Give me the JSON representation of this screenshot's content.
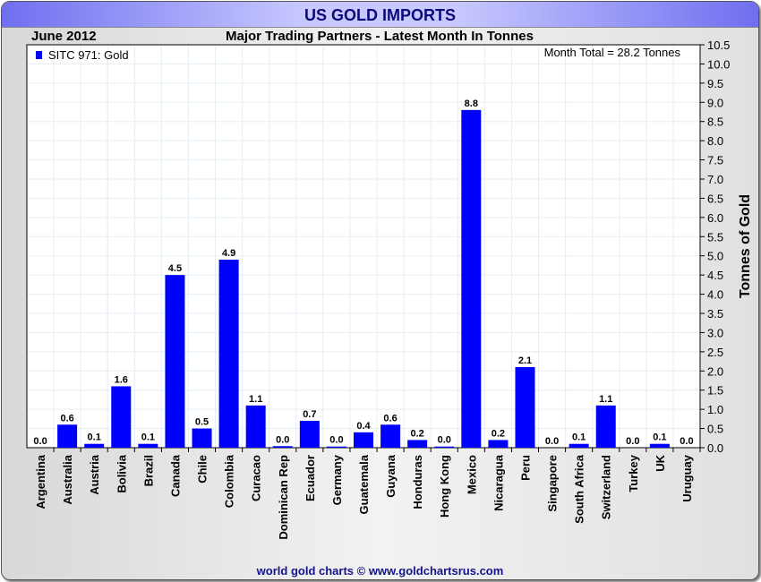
{
  "header": {
    "title": "US GOLD IMPORTS",
    "period": "June 2012",
    "subtitle": "Major Trading Partners - Latest Month In Tonnes"
  },
  "footer": "world gold charts © www.goldchartsrus.com",
  "chart_data": {
    "type": "bar",
    "title": "Major Trading Partners - Latest Month In Tonnes",
    "ylabel": "Tonnes of Gold",
    "ylim": [
      0,
      10.5
    ],
    "ytick_step": 0.5,
    "grid": true,
    "legend": {
      "label": "SITC 971: Gold",
      "placement": "top-left",
      "color": "#0000ff"
    },
    "annotation": "Month Total = 28.2 Tonnes",
    "categories": [
      "Argentina",
      "Australia",
      "Austria",
      "Bolivia",
      "Brazil",
      "Canada",
      "Chile",
      "Colombia",
      "Curacao",
      "Dominican Rep",
      "Ecuador",
      "Germany",
      "Guatemala",
      "Guyana",
      "Honduras",
      "Hong Kong",
      "Mexico",
      "Nicaragua",
      "Peru",
      "Singapore",
      "South Africa",
      "Switzerland",
      "Turkey",
      "UK",
      "Uruguay"
    ],
    "values": [
      0.0,
      0.6,
      0.1,
      1.6,
      0.1,
      4.5,
      0.5,
      4.9,
      1.1,
      0.04,
      0.7,
      0.03,
      0.4,
      0.6,
      0.2,
      0.03,
      8.8,
      0.2,
      2.1,
      0.0,
      0.1,
      1.1,
      0.0,
      0.1,
      0.0
    ],
    "bar_color": "#0000ff"
  }
}
